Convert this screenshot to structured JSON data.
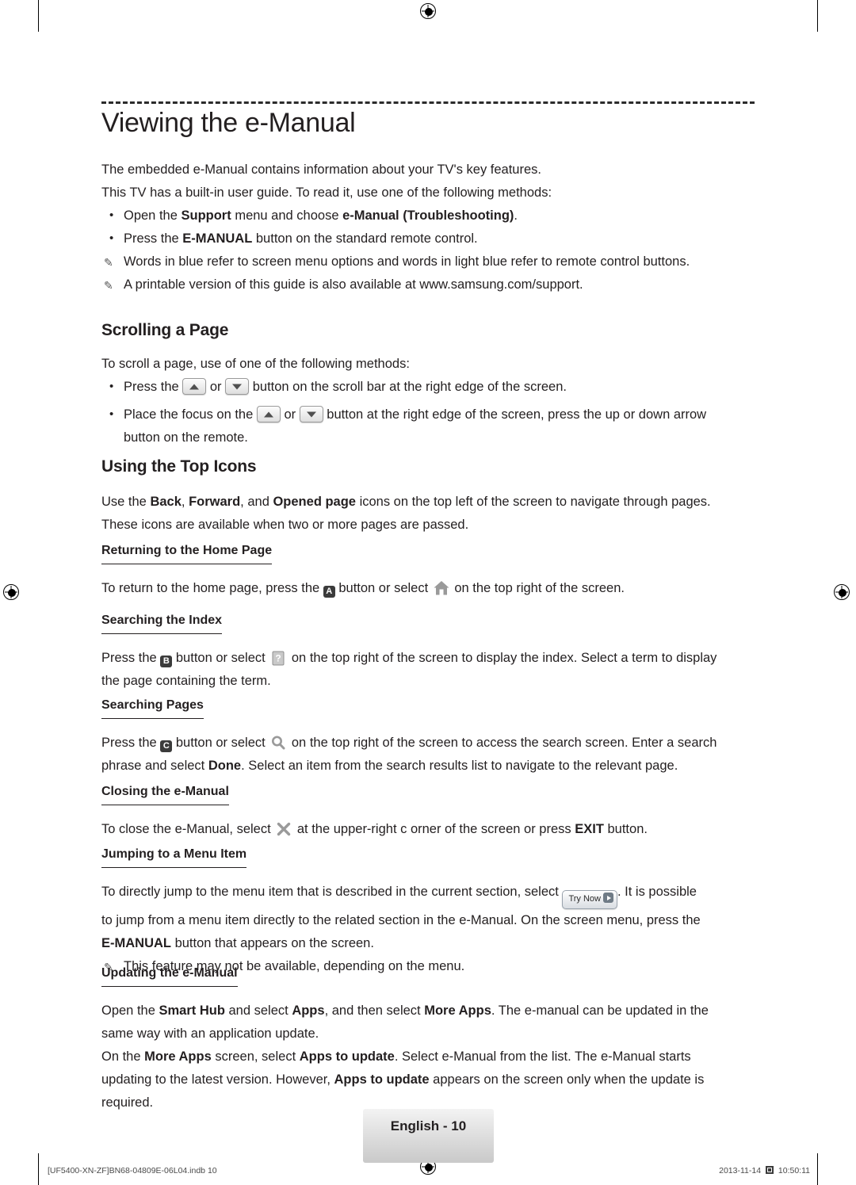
{
  "document": {
    "title": "Viewing the e-Manual",
    "intro": [
      "The embedded e-Manual contains information about your TV's key features.",
      "This TV has a built-in user guide. To read it, use one of the following methods:"
    ],
    "intro_bullets": [
      {
        "pre": "Open the ",
        "b1": "Support",
        "mid": " menu and choose ",
        "b2": "e-Manual (Troubleshooting)",
        "post": "."
      },
      {
        "pre": "Press the ",
        "b1": "E-MANUAL",
        "mid": " button on the standard remote control.",
        "b2": "",
        "post": ""
      }
    ],
    "intro_notes": [
      "Words in blue refer to screen menu options and words in light blue refer to remote control buttons.",
      "A printable version of this guide is also available at www.samsung.com/support."
    ],
    "sections": [
      {
        "heading": "Scrolling a Page",
        "lead": "To scroll a page, use of one of the following methods:",
        "bullet1_pre": "Press the ",
        "bullet1_or": " or ",
        "bullet1_post": " button on the scroll bar at the right edge of the screen.",
        "bullet2_pre": "Place the focus on the ",
        "bullet2_or": " or ",
        "bullet2_post": " button at the right edge of the screen, press the up or down arrow",
        "bullet2_line2": "button on the remote."
      },
      {
        "heading": "Using the Top Icons",
        "para_pre": "Use the ",
        "para_b1": "Back",
        "para_mid1": ", ",
        "para_b2": "Forward",
        "para_mid2": ", and ",
        "para_b3": "Opened page",
        "para_post": " icons on the top left of the screen to navigate through pages.",
        "para_line2": "These icons are available when two or more pages are passed."
      }
    ],
    "subsections": [
      {
        "heading": "Returning to the Home Page",
        "key": "A",
        "text_pre": "To return to the home page, press the ",
        "text_mid": " button or select ",
        "text_post": " on the top right of the screen.",
        "icon": "home-icon"
      },
      {
        "heading": "Searching the Index",
        "key": "B",
        "text_pre": "Press the ",
        "text_mid": " button or select ",
        "text_post": " on the top right of the screen to display the index. Select a term to display",
        "text_line2": "the page containing the term.",
        "icon": "index-icon"
      },
      {
        "heading": "Searching Pages",
        "key": "C",
        "text_pre": "Press the ",
        "text_mid": " button or select ",
        "text_post": " on the top right of the screen to access the search screen. Enter a search",
        "text_line2_pre": "phrase and select ",
        "text_line2_b": "Done",
        "text_line2_post": ". Select an item from the search results list to navigate to the relevant page.",
        "icon": "search-icon"
      },
      {
        "heading": "Closing the e-Manual",
        "text_pre": "To close the e-Manual, select ",
        "text_mid": " at the upper-right c orner of the screen or press ",
        "text_b": "EXIT",
        "text_post": " button.",
        "icon": "close-icon"
      },
      {
        "heading": "Jumping to a Menu Item",
        "text_pre": "To directly jump to the menu item that is described in the current section, select ",
        "trynow_label": "Try Now",
        "text_post": ". It is possible",
        "line2": "to jump from a menu item directly to the related section in the e-Manual. On the screen menu, press the",
        "line3_b": "E-MANUAL",
        "line3_post": " button that appears on the screen.",
        "note": "This feature may not be available, depending on the menu."
      },
      {
        "heading": "Updating the e-Manual",
        "p1_pre": "Open the ",
        "p1_b1": "Smart Hub",
        "p1_mid1": " and select ",
        "p1_b2": "Apps",
        "p1_mid2": ", and then select ",
        "p1_b3": "More Apps",
        "p1_post": ". The e-manual can be updated in the",
        "p1_line2": "same way with an application update.",
        "p2_pre": "On the ",
        "p2_b1": "More Apps",
        "p2_mid1": " screen, select ",
        "p2_b2": "Apps to update",
        "p2_mid2": ". Select e-Manual from the list. The e-Manual starts",
        "p2_line2_pre": "updating to the latest version. However, ",
        "p2_line2_b": "Apps to update",
        "p2_line2_post": " appears on the screen only when the update is",
        "p2_line3": "required."
      }
    ]
  },
  "footer": {
    "page_badge": "English - 10",
    "left": "[UF5400-XN-ZF]BN68-04809E-06L04.indb   10",
    "right_date": "2013-11-14",
    "right_time": "10:50:11"
  }
}
